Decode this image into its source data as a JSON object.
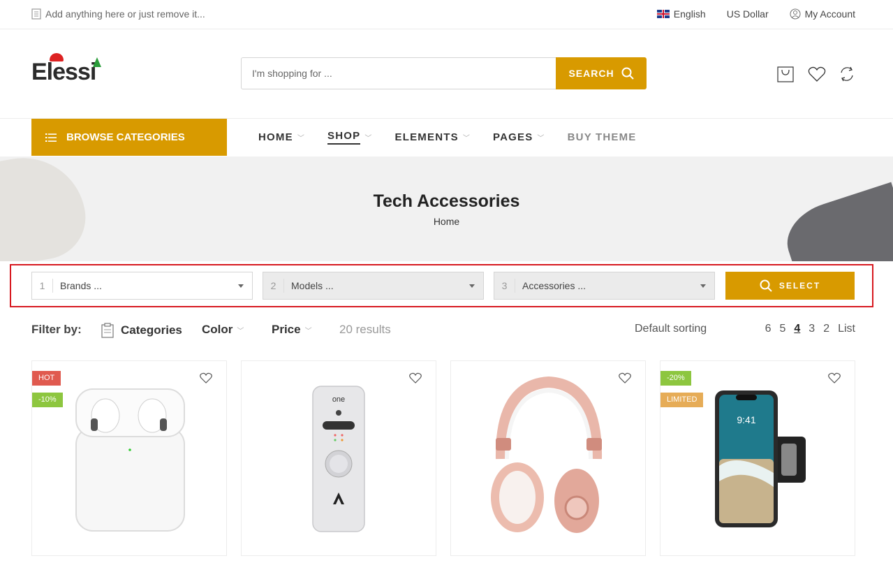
{
  "topbar": {
    "promo": "Add anything here or just remove it...",
    "language": "English",
    "currency": "US Dollar",
    "account": "My Account"
  },
  "header": {
    "logo": "Elessi",
    "search_placeholder": "I'm shopping for ...",
    "search_button": "SEARCH"
  },
  "nav": {
    "browse": "BROWSE CATEGORIES",
    "items": [
      {
        "label": "HOME"
      },
      {
        "label": "SHOP"
      },
      {
        "label": "ELEMENTS"
      },
      {
        "label": "PAGES"
      },
      {
        "label": "BUY THEME"
      }
    ]
  },
  "banner": {
    "title": "Tech Accessories",
    "breadcrumb": "Home"
  },
  "finder": {
    "steps": [
      {
        "num": "1",
        "label": "Brands ..."
      },
      {
        "num": "2",
        "label": "Models ..."
      },
      {
        "num": "3",
        "label": "Accessories ..."
      }
    ],
    "button": "SELECT"
  },
  "filter": {
    "label": "Filter by:",
    "categories": "Categories",
    "color": "Color",
    "price": "Price",
    "results": "20 results",
    "sorting": "Default sorting",
    "columns": [
      "6",
      "5",
      "4",
      "3",
      "2",
      "List"
    ],
    "active_column": "4"
  },
  "products": [
    {
      "badges": [
        "HOT",
        "-10%"
      ],
      "image": "airpods-case"
    },
    {
      "badges": [],
      "image": "apogee-one-audio-interface"
    },
    {
      "badges": [],
      "image": "rose-gold-headphones"
    },
    {
      "badges": [
        "-20%",
        "LIMITED"
      ],
      "image": "iphone-armband"
    }
  ],
  "colors": {
    "accent": "#d89a00",
    "highlight_border": "#d71920",
    "badge_hot": "#e05a4f",
    "badge_sale": "#8dc63f",
    "badge_limited": "#e6ac57"
  }
}
